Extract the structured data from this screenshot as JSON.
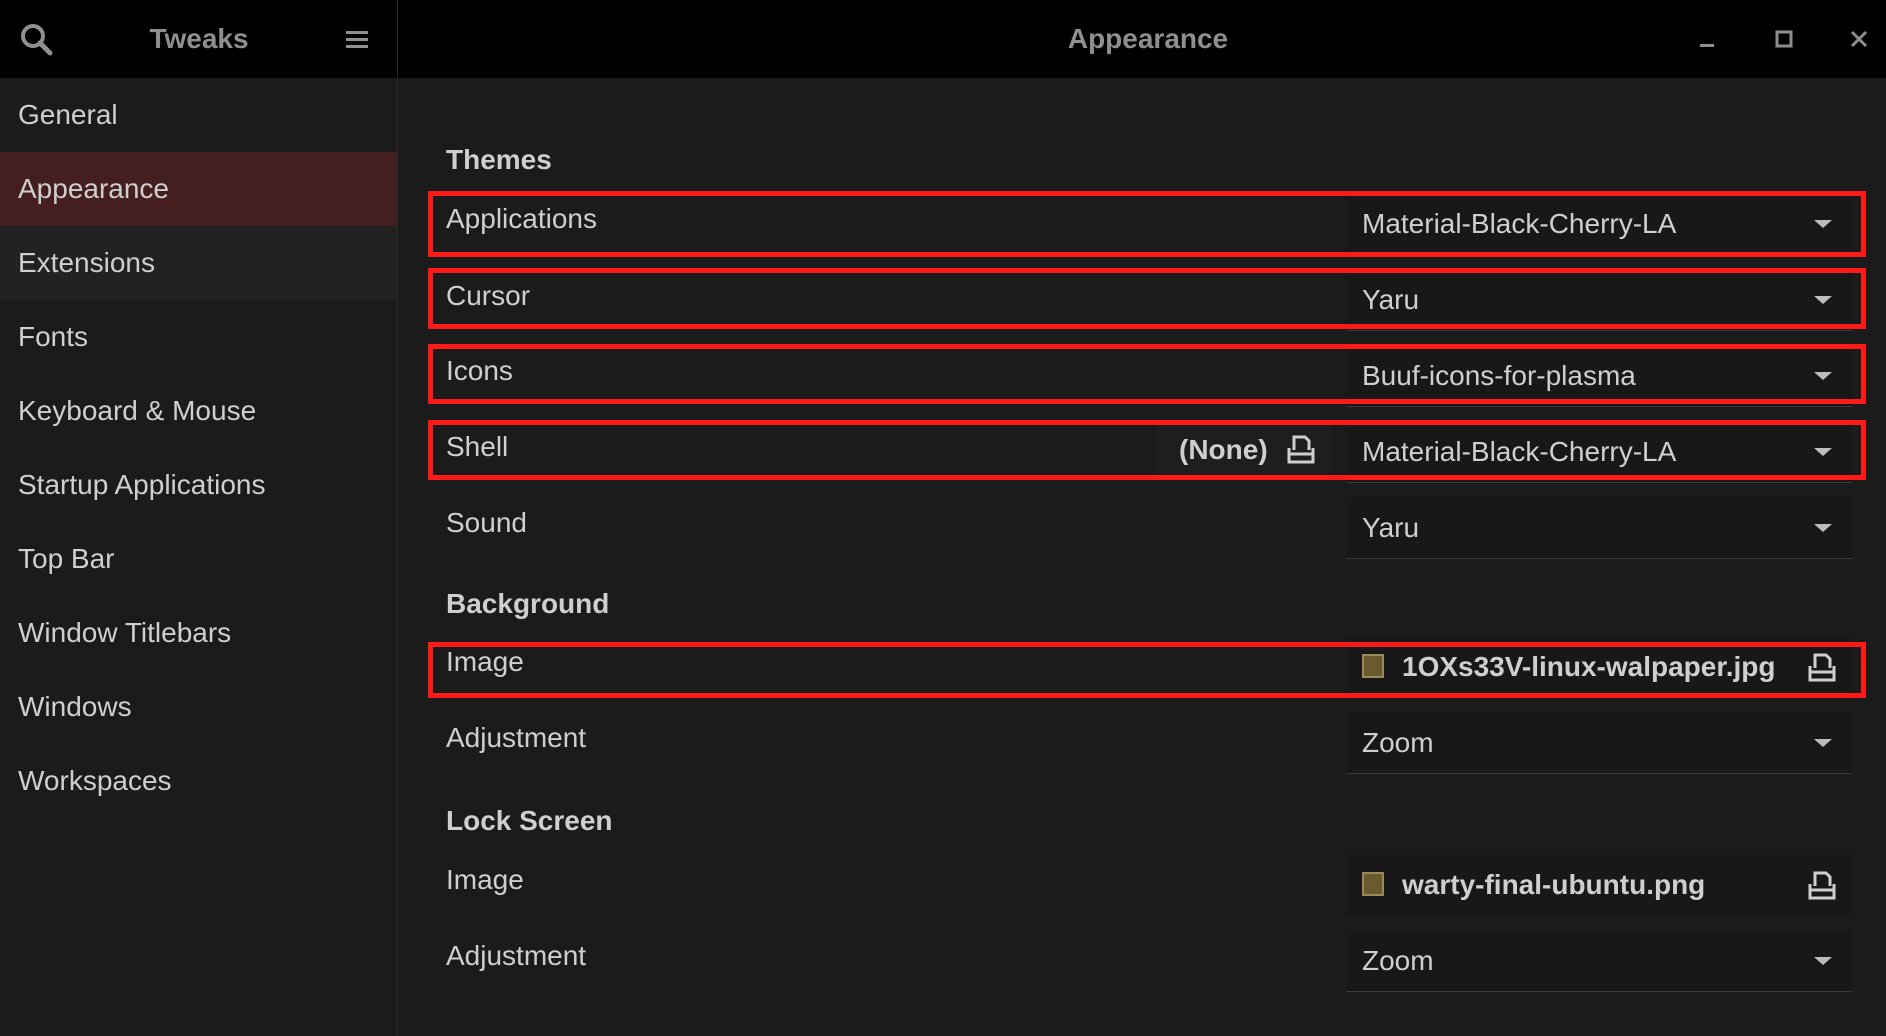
{
  "window": {
    "sidebar_title": "Tweaks",
    "title": "Appearance"
  },
  "icons": {
    "search": "search-icon",
    "menu": "hamburger-menu-icon",
    "minimize": "minimize-icon",
    "maximize": "maximize-icon",
    "close": "close-icon"
  },
  "sidebar": {
    "items": [
      {
        "label": "General"
      },
      {
        "label": "Appearance",
        "active": true
      },
      {
        "label": "Extensions"
      },
      {
        "label": "Fonts"
      },
      {
        "label": "Keyboard & Mouse"
      },
      {
        "label": "Startup Applications"
      },
      {
        "label": "Top Bar"
      },
      {
        "label": "Window Titlebars"
      },
      {
        "label": "Windows"
      },
      {
        "label": "Workspaces"
      }
    ]
  },
  "themes": {
    "section": "Themes",
    "applications": {
      "label": "Applications",
      "value": "Material-Black-Cherry-LA"
    },
    "cursor": {
      "label": "Cursor",
      "value": "Yaru"
    },
    "icons": {
      "label": "Icons",
      "value": "Buuf-icons-for-plasma"
    },
    "shell": {
      "label": "Shell",
      "none_label": "(None)",
      "value": "Material-Black-Cherry-LA"
    },
    "sound": {
      "label": "Sound",
      "value": "Yaru"
    }
  },
  "background": {
    "section": "Background",
    "image": {
      "label": "Image",
      "file": "1OXs33V-linux-walpaper.jpg"
    },
    "adjustment": {
      "label": "Adjustment",
      "value": "Zoom"
    }
  },
  "lock_screen": {
    "section": "Lock Screen",
    "image": {
      "label": "Image",
      "file": "warty-final-ubuntu.png"
    },
    "adjustment": {
      "label": "Adjustment",
      "value": "Zoom"
    }
  },
  "highlight_color": "#ff1a1a",
  "active_item_color": "#451f20"
}
